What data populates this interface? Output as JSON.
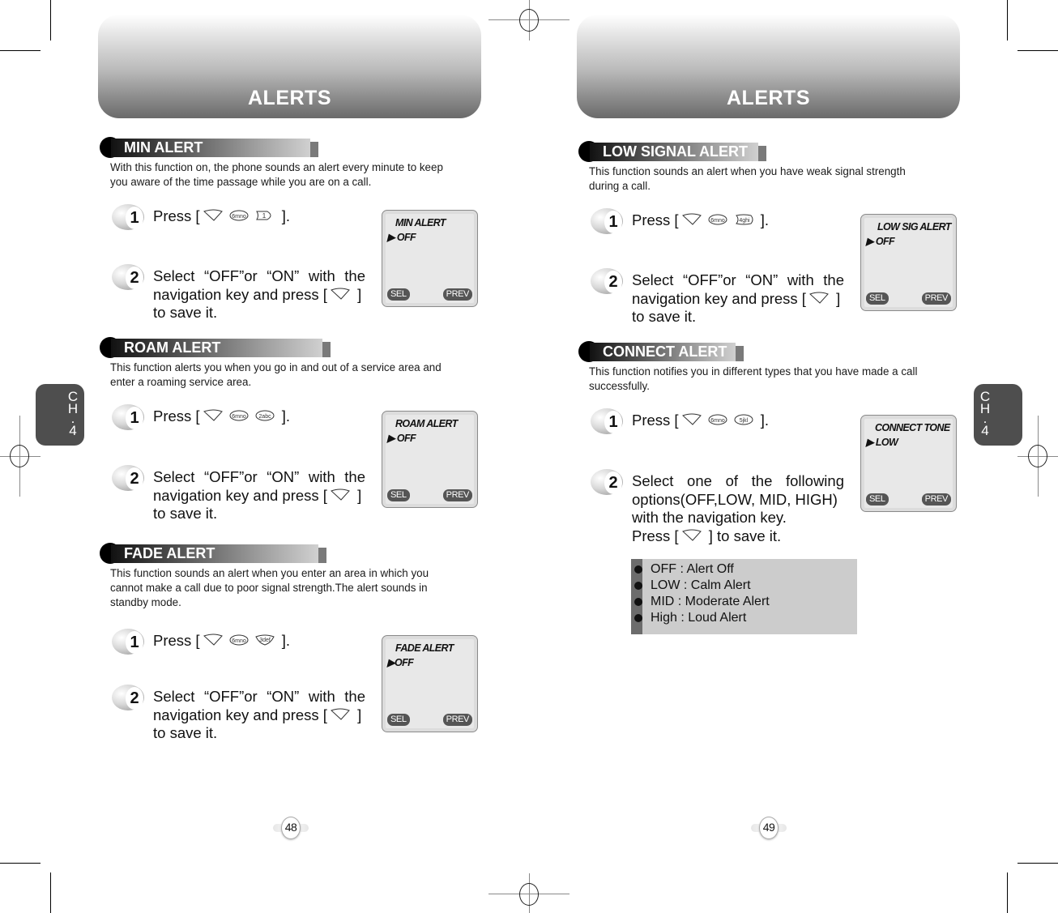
{
  "pages": [
    {
      "header": {
        "title": "ALERTS"
      },
      "chapter_tab": {
        "c": "C",
        "h": "H",
        "dot": ".",
        "num": "4"
      },
      "page_number": "48",
      "sections": [
        {
          "title": "MIN ALERT",
          "description": [
            "With this function on, the phone sounds an alert every minute to keep",
            "you aware of the time passage while you are on a call."
          ],
          "step1": {
            "number": "1",
            "prefix": "Press [",
            "suffix": " ].",
            "keys": [
              "menu-key-icon",
              "6mno-key-icon",
              "1-key-icon"
            ]
          },
          "step2": {
            "number": "2",
            "lines": [
              "Select “OFF”or “ON” with the",
              "navigation key and press [",
              "to save it."
            ],
            "key_suffix": " ]"
          },
          "screen": {
            "title": "MIN ALERT",
            "value": "▶ OFF",
            "left_soft": "SEL",
            "right_soft": "PREV"
          }
        },
        {
          "title": "ROAM ALERT",
          "description": [
            "This function alerts you when you go in and out of a service area and",
            "enter a roaming service area."
          ],
          "step1": {
            "number": "1",
            "prefix": "Press [",
            "suffix": " ].",
            "keys": [
              "menu-key-icon",
              "6mno-key-icon",
              "2abc-key-icon"
            ]
          },
          "step2": {
            "number": "2",
            "lines": [
              "Select “OFF”or “ON” with the",
              "navigation key and press [",
              "to save it."
            ],
            "key_suffix": " ]"
          },
          "screen": {
            "title": "ROAM ALERT",
            "value": "▶ OFF",
            "left_soft": "SEL",
            "right_soft": "PREV"
          }
        },
        {
          "title": "FADE ALERT",
          "description": [
            "This function sounds an alert when you enter an area in which you",
            "cannot make a call due to poor signal strength.The alert sounds in",
            "standby mode."
          ],
          "step1": {
            "number": "1",
            "prefix": "Press [",
            "suffix": " ].",
            "keys": [
              "menu-key-icon",
              "6mno-key-icon",
              "3def-key-icon"
            ]
          },
          "step2": {
            "number": "2",
            "lines": [
              "Select “OFF”or “ON” with the",
              "navigation key and press [",
              "to save it."
            ],
            "key_suffix": " ]"
          },
          "screen": {
            "title": "FADE ALERT",
            "value": "▶OFF",
            "left_soft": "SEL",
            "right_soft": "PREV"
          }
        }
      ]
    },
    {
      "header": {
        "title": "ALERTS"
      },
      "chapter_tab": {
        "c": "C",
        "h": "H",
        "dot": ".",
        "num": "4"
      },
      "page_number": "49",
      "sections": [
        {
          "title": "LOW SIGNAL ALERT",
          "description": [
            "This function sounds an alert when you have weak signal strength",
            "during a call."
          ],
          "step1": {
            "number": "1",
            "prefix": "Press [",
            "suffix": " ].",
            "keys": [
              "menu-key-icon",
              "6mno-key-icon",
              "4ghi-key-icon"
            ]
          },
          "step2": {
            "number": "2",
            "lines": [
              "Select “OFF”or “ON” with the",
              "navigation key and press [",
              "to save it."
            ],
            "key_suffix": " ]"
          },
          "screen": {
            "title": "LOW SIG ALERT",
            "value": "▶ OFF",
            "left_soft": "SEL",
            "right_soft": "PREV"
          }
        },
        {
          "title": "CONNECT ALERT",
          "description": [
            "This function notifies you in different types that you have made a call",
            "successfully."
          ],
          "step1": {
            "number": "1",
            "prefix": "Press [",
            "suffix": " ].",
            "keys": [
              "menu-key-icon",
              "6mno-key-icon",
              "5jkl-key-icon"
            ]
          },
          "step2": {
            "number": "2",
            "lines": [
              "Select one of the following",
              "options(OFF,LOW, MID, HIGH)",
              "with the navigation key.",
              "Press ["
            ],
            "key_suffix": " ] to save it."
          },
          "screen": {
            "title": "CONNECT TONE",
            "value": "▶ LOW",
            "left_soft": "SEL",
            "right_soft": "PREV"
          },
          "options": [
            "OFF : Alert Off",
            "LOW : Calm Alert",
            "MID : Moderate Alert",
            "High : Loud Alert"
          ]
        }
      ]
    }
  ],
  "keys": {
    "menu-key-icon": "",
    "6mno-key-icon": "6MNO",
    "1-key-icon": "1",
    "2abc-key-icon": "2ABC",
    "3def-key-icon": "3DEF",
    "4ghi-key-icon": "4GHI",
    "5jkl-key-icon": "5JKL"
  },
  "colors": {
    "header_dark": "#6a6a6a",
    "tab": "#4e4e4e",
    "options_bg": "#cccccc",
    "options_stripe": "#6c6c6c"
  }
}
